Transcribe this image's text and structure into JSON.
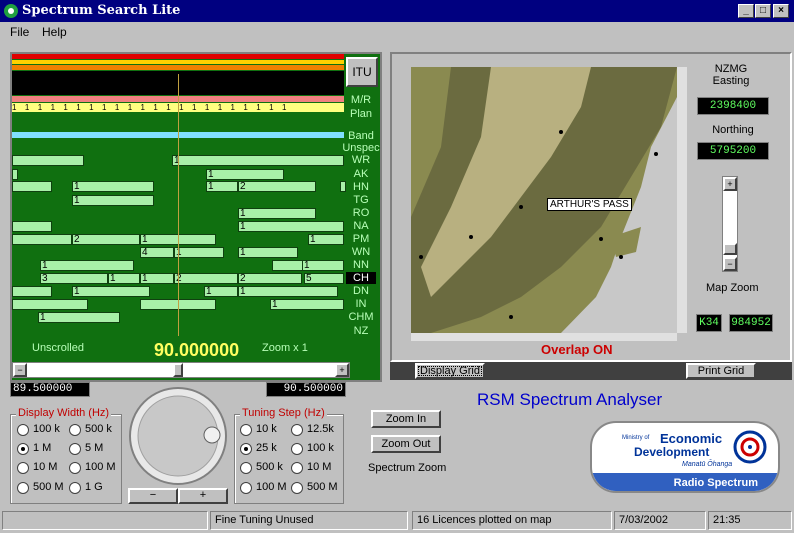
{
  "window": {
    "title": "Spectrum Search Lite"
  },
  "menu": [
    "File",
    "Help"
  ],
  "spectrum": {
    "itu_button": "ITU",
    "services": [
      "M/R",
      "Plan",
      "Band",
      "Unspec",
      "WR",
      "AK",
      "HN",
      "TG",
      "RO",
      "NA",
      "PM",
      "WN",
      "NN",
      "CH",
      "DN",
      "IN",
      "CHM",
      "NZ"
    ],
    "selected_service": "CH",
    "scroll_label": "Unscrolled",
    "center_freq": "90.000000",
    "zoom_label": "Zoom x 1",
    "low_freq": "89.500000",
    "high_freq": "90.500000"
  },
  "map": {
    "easting_label": "NZMG\nEasting",
    "easting_value": "2398400",
    "northing_label": "Northing",
    "northing_value": "5795200",
    "place_label": "ARTHUR'S PASS",
    "zoom_label": "Map Zoom",
    "grid_code": "K34",
    "grid_ref": "984952",
    "overlap_text": "Overlap ON",
    "display_grid_button": "Display Grid",
    "print_grid_button": "Print Grid"
  },
  "display_width": {
    "title": "Display Width (Hz)",
    "options": [
      "100 k",
      "500 k",
      "1 M",
      "5 M",
      "10 M",
      "100 M",
      "500 M",
      "1 G"
    ],
    "selected": "1 M"
  },
  "tuning_step": {
    "title": "Tuning Step (Hz)",
    "options": [
      "10 k",
      "12.5k",
      "25 k",
      "100 k",
      "500 k",
      "10 M",
      "100 M",
      "500 M"
    ],
    "selected": "25 k"
  },
  "knob": {
    "minus": "−",
    "plus": "+"
  },
  "zoom": {
    "in": "Zoom In",
    "out": "Zoom Out",
    "label": "Spectrum Zoom"
  },
  "app_title": "RSM Spectrum Analyser",
  "logo": {
    "line1": "Ministry of",
    "line2": "Economic",
    "line3": "Development",
    "line4": "Manatū Ōhanga",
    "band": "Radio Spectrum"
  },
  "status": {
    "fine_tuning": "Fine Tuning Unused",
    "licences": "16 Licences plotted on map",
    "date": "7/03/2002",
    "time": "21:35"
  },
  "colors": {
    "title_bg": "#000080",
    "spectrum_bg": "#107010",
    "lcd_text": "#60ff60",
    "app_title": "#0000cc",
    "overlap": "#cc0000"
  }
}
